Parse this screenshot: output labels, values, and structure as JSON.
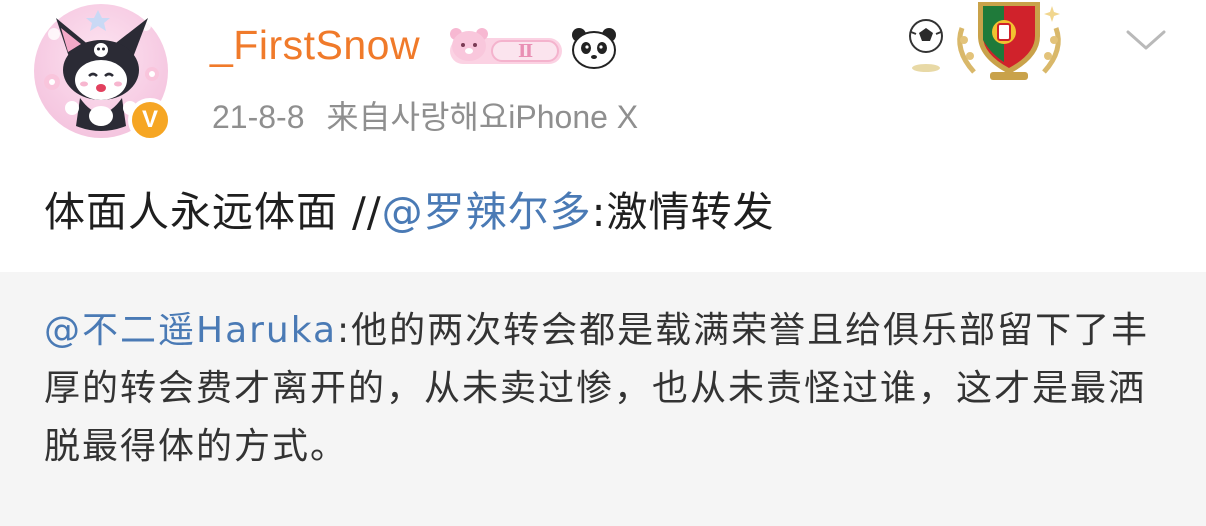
{
  "post": {
    "username": "_FirstSnow",
    "date": "21-8-8",
    "source_prefix": "来自",
    "source_device": "사랑해요iPhone X",
    "level_badge": "Ⅱ",
    "verified_mark": "V",
    "text_prefix": "体面人永远体面 //",
    "text_mention": "@罗辣尔多",
    "text_suffix": ":激情转发"
  },
  "repost": {
    "mention": "@不二遥Haruka",
    "text": ":他的两次转会都是载满荣誉且给俱乐部留下了丰厚的转会费才离开的，从未卖过惨，也从未责怪过谁，这才是最洒脱最得体的方式。"
  },
  "icons": {
    "avatar": "kuromi-avatar",
    "verified": "orange-verified-icon",
    "badges": [
      "pink-bear-badge-icon",
      "panda-icon"
    ],
    "decor": [
      "soccer-ball-icon",
      "portugal-shield-icon"
    ],
    "menu": "chevron-down-icon"
  },
  "colors": {
    "username": "#f07a2a",
    "mention": "#4a7ab5",
    "meta": "#8f8f8f",
    "repost_bg": "#f5f5f5"
  }
}
